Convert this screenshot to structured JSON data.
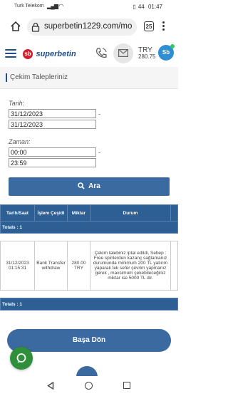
{
  "status_bar": {
    "carrier": "Turk Telekom",
    "battery": "44",
    "time": "01:47"
  },
  "browser": {
    "url": "superbetin1229.com/mo",
    "tab_count": "25"
  },
  "site_header": {
    "logo_badge": "sb",
    "logo_text": "superbetin",
    "currency": "TRY",
    "balance": "280.75",
    "avatar_initials": "Sb"
  },
  "page_title": "Çekim Talepleriniz",
  "form": {
    "date_label": "Tarih:",
    "date_from": "31/12/2023",
    "date_to": "31/12/2023",
    "time_label": "Zaman:",
    "time_from": "00:00",
    "time_to": "23:59",
    "range_separator": "-",
    "search_label": "Ara"
  },
  "table": {
    "headers": [
      "Tarih/Saat",
      "İşlem Çeşidi",
      "Miktar",
      "Durum"
    ],
    "totals_label": "Totals : 1",
    "row": {
      "datetime": "31/12/2023 01:15:31",
      "type": "Bank Transfer withdraw",
      "amount": "280.00 TRY",
      "status": "Çekim talebiniz iptal edildi, Sebep : Free spinlerden kazanç sağlamanız durumunda minimum 200 TL yatırım yaparak tek sefer çevrim yapmanız gerek , maxsimum çekebileceğiniz miktar ise 5000 TL dir."
    }
  },
  "back_button": "Başa Dön",
  "colors": {
    "primary": "#3b6aa0",
    "table_header": "#2d5f95",
    "chat_green": "#2f8f3a",
    "logo_red": "#d31e2d"
  }
}
